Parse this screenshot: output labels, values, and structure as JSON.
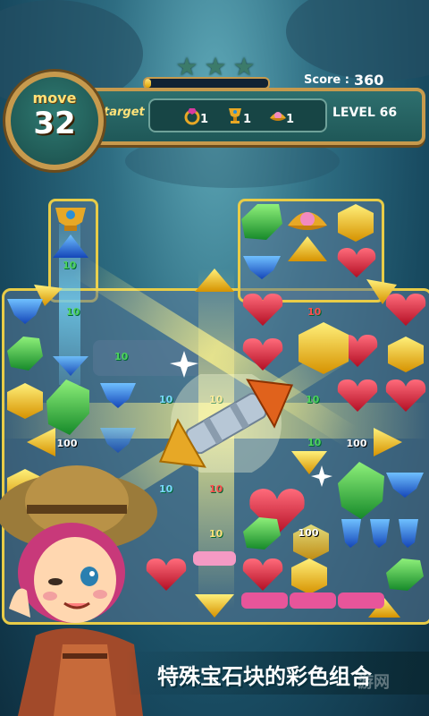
{
  "hud": {
    "move_label": "move",
    "move_value": "32",
    "score_label": "Score :",
    "score_value": "360",
    "target_label": "target",
    "level_label": "LEVEL 66",
    "stars_earned": 0,
    "stars_total": 3,
    "progress_fraction": 0.05,
    "targets": [
      {
        "icon": "ring-icon",
        "count": "1"
      },
      {
        "icon": "trophy-cup-icon",
        "count": "1"
      },
      {
        "icon": "pearl-shell-icon",
        "count": "1"
      }
    ]
  },
  "board_popups": {
    "ten": "10",
    "hundred": "100"
  },
  "caption": "特殊宝石块的彩色组合",
  "watermark": "游网",
  "colors": {
    "frame_gold": "#e8cc47",
    "hud_teal": "#1f5858",
    "gem_red": "#e0223a",
    "gem_blue": "#1f6fe0",
    "gem_green": "#2eb33b",
    "gem_yellow": "#f3c21a"
  }
}
